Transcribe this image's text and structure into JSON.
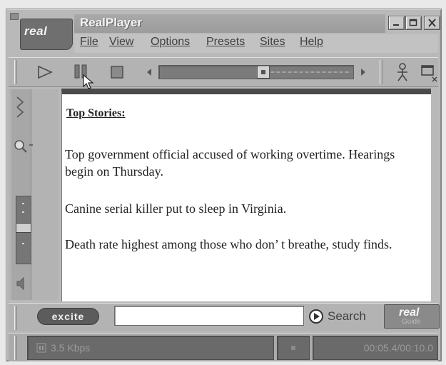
{
  "window": {
    "title": "RealPlayer",
    "logo": "real"
  },
  "menu": [
    "File",
    "View",
    "Options",
    "Presets",
    "Sites",
    "Help"
  ],
  "toolbar": {
    "play": "play-icon",
    "pause": "pause-icon",
    "stop": "stop-icon"
  },
  "content": {
    "heading": "Top Stories:",
    "stories": [
      "Top government official accused of working overtime. Hearings begin on Thursday.",
      "Canine serial killer put to sleep in Virginia.",
      "Death rate highest among those who don’ t breathe, study finds."
    ]
  },
  "search": {
    "brand": "excite",
    "value": "",
    "button_label": "Search",
    "guide_brand": "real",
    "guide_sub": "Guide"
  },
  "status": {
    "bitrate": "3.5 Kbps",
    "time": "00:05.4/00:10.0"
  }
}
